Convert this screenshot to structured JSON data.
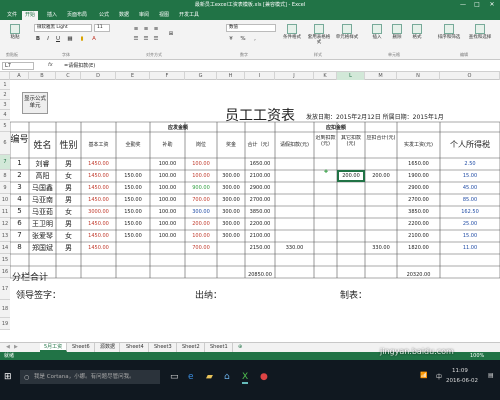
{
  "window": {
    "title": "最新员工excel工资表模板.xls [兼容模式] - Excel",
    "minimize": "—",
    "maximize": "□",
    "close": "✕"
  },
  "ribbon_tabs": [
    "文件",
    "开始",
    "插入",
    "页面布局",
    "公式",
    "数据",
    "审阅",
    "视图",
    "开发工具"
  ],
  "ribbon": {
    "font_name": "微软雅黑 Light",
    "font_size": "11",
    "number_format": "数值",
    "buttons": {
      "paste": "粘贴",
      "cond_format": "条件格式",
      "table_format": "套用表格格式",
      "cell_style": "单元格样式",
      "insert": "插入",
      "delete": "删除",
      "format": "格式",
      "sort_filter": "排序和筛选",
      "find_select": "查找和选择"
    },
    "groups": {
      "clipboard": "剪贴板",
      "font": "字体",
      "align": "对齐方式",
      "number": "数字",
      "styles": "样式",
      "cells": "单元格",
      "editing": "编辑"
    }
  },
  "formula_bar": {
    "name_box": "L7",
    "fx": "fx",
    "content": "=请假扣款(E)"
  },
  "columns": [
    "A",
    "B",
    "C",
    "D",
    "E",
    "F",
    "G",
    "H",
    "I",
    "J",
    "K",
    "L",
    "M",
    "N",
    "O"
  ],
  "selected_column": "L",
  "row_numbers": [
    "1",
    "2",
    "3",
    "4",
    "5",
    "6",
    "7",
    "8",
    "9",
    "10",
    "11",
    "12",
    "13",
    "14",
    "15",
    "16",
    "17",
    "18",
    "19"
  ],
  "selected_row": "7",
  "sheet": {
    "button_label": "显示公式单元",
    "title": "员工工资表",
    "date_label": "发放日期：2015年2月12日 所属日期：2015年1月",
    "group_payable": "应发金额",
    "group_deduct": "应扣金额",
    "headers": {
      "no": "编号",
      "name": "姓名",
      "gender": "性别",
      "base": "基本工资",
      "allowance": "全勤奖",
      "subsidy": "补助",
      "post": "岗位",
      "bonus": "奖金",
      "total": "合计（元）",
      "leave": "请假扣款(元)",
      "late": "迟到扣款(元)",
      "other": "其它扣款(元)",
      "deduct_total": "应扣合计(元)",
      "net": "实发工资(元)",
      "tax": "个人所得税"
    },
    "rows": [
      {
        "no": "1",
        "name": "刘睿",
        "gender": "男",
        "base": "1450.00",
        "allowance": "",
        "subsidy": "100.00",
        "post": "100.00",
        "bonus": "",
        "total": "1650.00",
        "leave": "",
        "late": "",
        "other": "",
        "dtotal": "",
        "net": "1650.00",
        "tax": "2.50"
      },
      {
        "no": "2",
        "name": "高阳",
        "gender": "女",
        "base": "1450.00",
        "allowance": "150.00",
        "subsidy": "100.00",
        "post": "100.00",
        "bonus": "300.00",
        "total": "2100.00",
        "leave": "",
        "late": "",
        "other": "200.00",
        "dtotal": "200.00",
        "net": "1900.00",
        "tax": "15.00"
      },
      {
        "no": "3",
        "name": "马国鑫",
        "gender": "男",
        "base": "1450.00",
        "allowance": "150.00",
        "subsidy": "100.00",
        "post": "900.00",
        "bonus": "300.00",
        "total": "2900.00",
        "leave": "",
        "late": "",
        "other": "",
        "dtotal": "",
        "net": "2900.00",
        "tax": "45.00"
      },
      {
        "no": "4",
        "name": "马亚南",
        "gender": "男",
        "base": "1450.00",
        "allowance": "150.00",
        "subsidy": "100.00",
        "post": "700.00",
        "bonus": "300.00",
        "total": "2700.00",
        "leave": "",
        "late": "",
        "other": "",
        "dtotal": "",
        "net": "2700.00",
        "tax": "85.00"
      },
      {
        "no": "5",
        "name": "马亚茹",
        "gender": "女",
        "base": "3000.00",
        "allowance": "150.00",
        "subsidy": "100.00",
        "post": "300.00",
        "bonus": "300.00",
        "total": "3850.00",
        "leave": "",
        "late": "",
        "other": "",
        "dtotal": "",
        "net": "3850.00",
        "tax": "162.50"
      },
      {
        "no": "6",
        "name": "王卫明",
        "gender": "男",
        "base": "1450.00",
        "allowance": "150.00",
        "subsidy": "100.00",
        "post": "200.00",
        "bonus": "300.00",
        "total": "2200.00",
        "leave": "",
        "late": "",
        "other": "",
        "dtotal": "",
        "net": "2200.00",
        "tax": "25.00"
      },
      {
        "no": "7",
        "name": "张爱琴",
        "gender": "女",
        "base": "1450.00",
        "allowance": "150.00",
        "subsidy": "100.00",
        "post": "100.00",
        "bonus": "300.00",
        "total": "2100.00",
        "leave": "",
        "late": "",
        "other": "",
        "dtotal": "",
        "net": "2100.00",
        "tax": "15.00"
      },
      {
        "no": "8",
        "name": "郑国斌",
        "gender": "男",
        "base": "1450.00",
        "allowance": "",
        "subsidy": "",
        "post": "700.00",
        "bonus": "",
        "total": "2150.00",
        "leave": "330.00",
        "late": "",
        "other": "",
        "dtotal": "330.00",
        "net": "1820.00",
        "tax": "11.00"
      }
    ],
    "empty_rows": [
      "9",
      "10",
      "11"
    ],
    "subtotal_label": "分栏合计",
    "subtotal_total": "20850.00",
    "subtotal_net": "20320.00",
    "sign_leader": "领导签字：",
    "sign_cashier": "出纳：",
    "sign_maker": "制表："
  },
  "sheet_tabs": [
    "5月工资",
    "Sheet6",
    "源数据",
    "Sheet4",
    "Sheet3",
    "Sheet2",
    "Sheet1"
  ],
  "status": {
    "ready": "就绪",
    "zoom": "100%"
  },
  "taskbar": {
    "search_placeholder": "我是 Cortana，小娜。有问题尽管问我。",
    "time": "11:09",
    "date": "2016-06-02",
    "lang": "中"
  },
  "watermark": "jingyan.baidu.com",
  "colors": {
    "accent": "#217346",
    "red": "#c0392b",
    "blue": "#1f4ba5",
    "green": "#2e9e3e"
  }
}
